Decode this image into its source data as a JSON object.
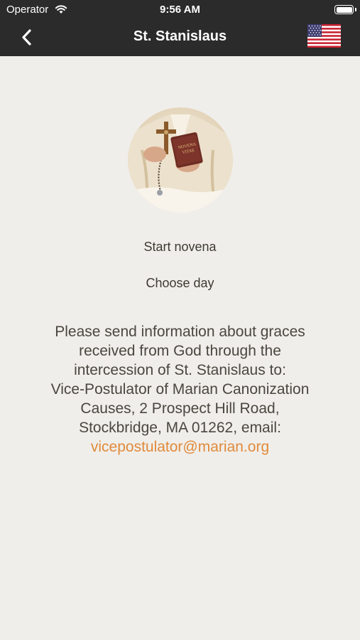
{
  "status_bar": {
    "carrier": "Operator",
    "time": "9:56 AM"
  },
  "navbar": {
    "title": "St. Stanislaus",
    "back_icon": "chevron-left-icon",
    "language_icon": "us-flag-icon"
  },
  "portrait": {
    "description_icon": "saint-portrait-image",
    "book_text": "NOVENA VITAE"
  },
  "actions": {
    "start_novena": "Start novena",
    "choose_day": "Choose day"
  },
  "info": {
    "lines": [
      "Please send information about graces",
      "received from God through the",
      "intercession of St. Stanislaus to:",
      "Vice-Postulator of Marian Canonization",
      "Causes, 2 Prospect Hill Road,",
      "Stockbridge, MA 01262, email:"
    ],
    "email": "vicepostulator@marian.org"
  },
  "colors": {
    "bar": "#2b2b2b",
    "background": "#f0eeea",
    "accent": "#e08a3c",
    "text": "#4a4640"
  }
}
